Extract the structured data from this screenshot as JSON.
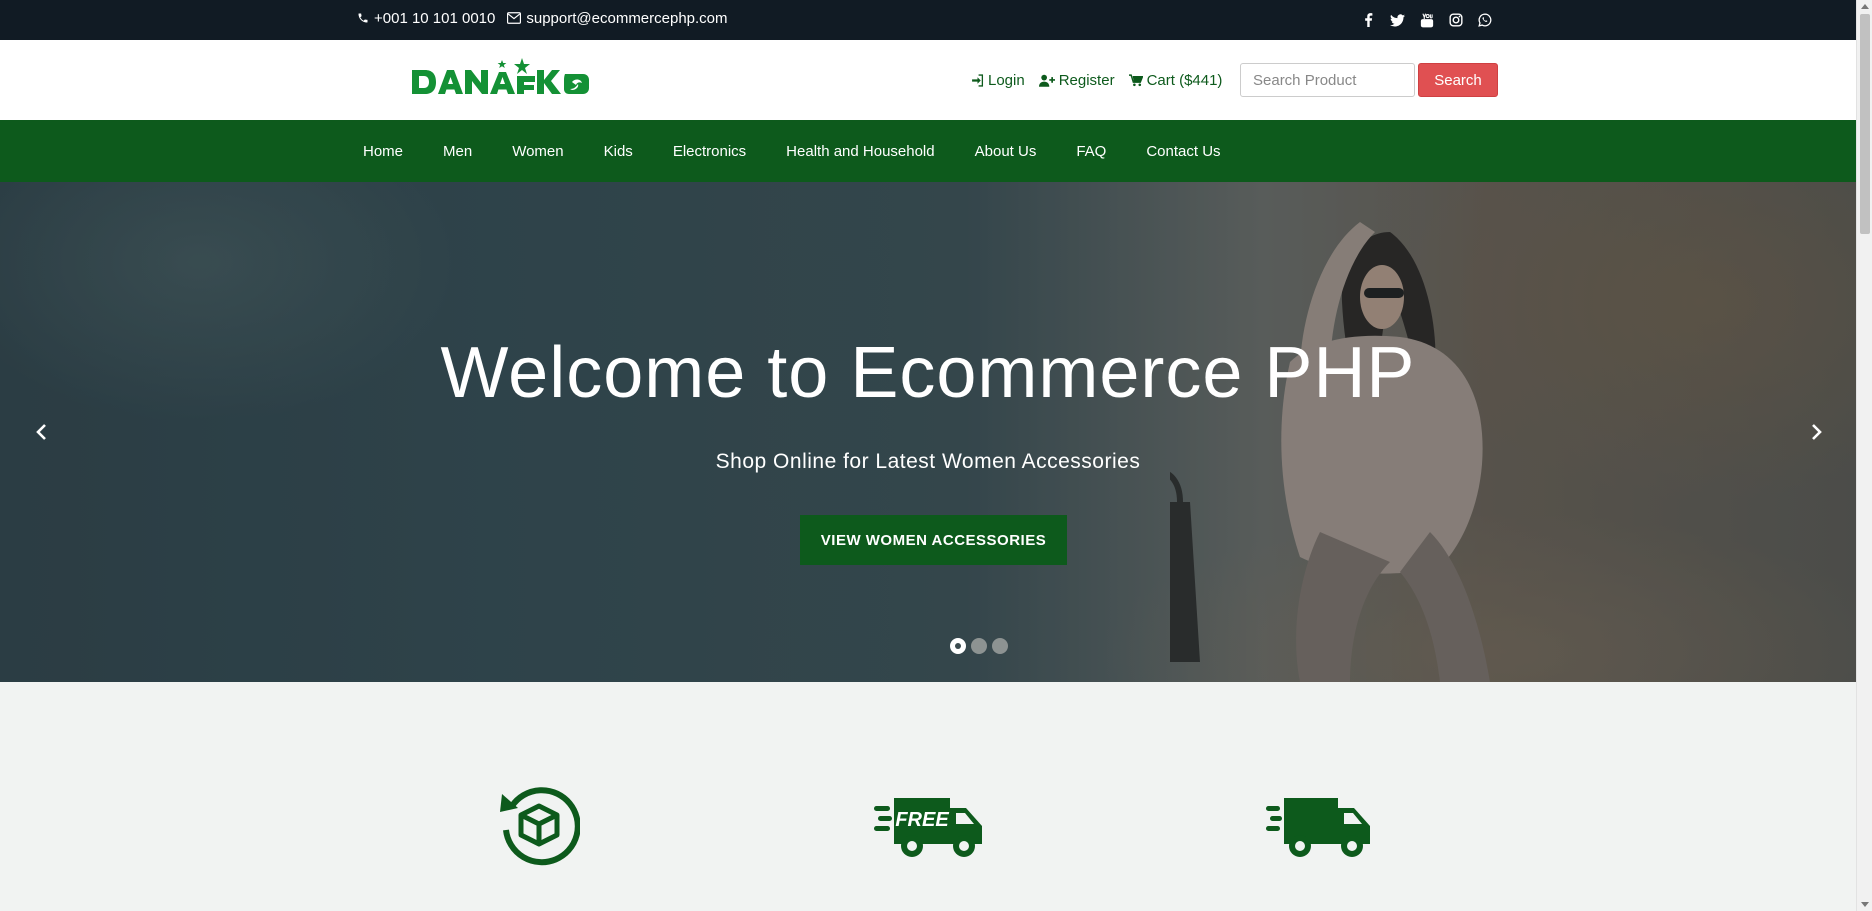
{
  "topbar": {
    "phone": "+001 10 101 0010",
    "email": "support@ecommercephp.com",
    "social_icons": [
      "facebook-icon",
      "twitter-icon",
      "youtube-icon",
      "instagram-icon",
      "whatsapp-icon"
    ]
  },
  "header": {
    "logo_text": "DANAEKO",
    "login_label": "Login",
    "register_label": "Register",
    "cart_label": "Cart ($441)",
    "search_placeholder": "Search Product",
    "search_button": "Search"
  },
  "nav": {
    "items": [
      "Home",
      "Men",
      "Women",
      "Kids",
      "Electronics",
      "Health and Household",
      "About Us",
      "FAQ",
      "Contact Us"
    ]
  },
  "hero": {
    "title": "Welcome to Ecommerce PHP",
    "subtitle": "Shop Online for Latest Women Accessories",
    "cta_label": "VIEW WOMEN ACCESSORIES",
    "slide_count": 3,
    "active_slide": 1
  },
  "features": {
    "icons": [
      "returns-box-icon",
      "free-shipping-truck-icon",
      "fast-delivery-truck-icon"
    ]
  },
  "colors": {
    "brand_green": "#0d5a1c",
    "topbar_bg": "#111b24",
    "search_button": "#e05052",
    "page_bg": "#f1f3f2"
  }
}
